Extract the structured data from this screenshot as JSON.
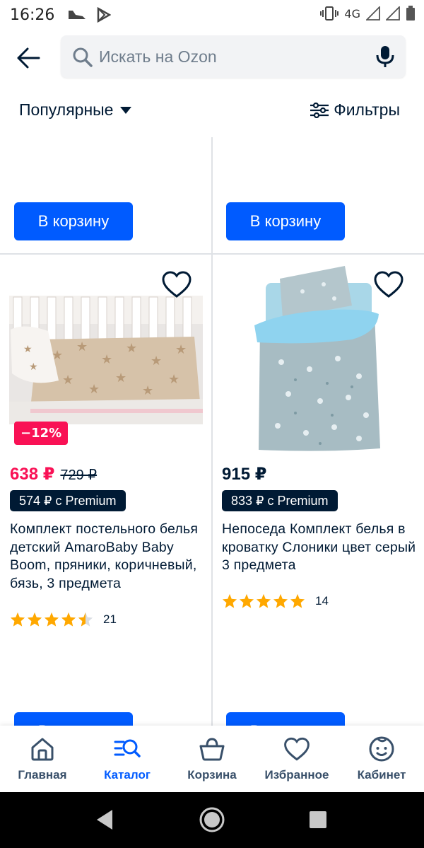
{
  "status_bar": {
    "time": "16:26",
    "network": "4G"
  },
  "search": {
    "placeholder": "Искать на Ozon"
  },
  "sort_bar": {
    "sort_label": "Популярные",
    "filter_label": "Фильтры"
  },
  "top_row": {
    "left_cart_label": "В корзину",
    "right_cart_label": "В корзину"
  },
  "products": [
    {
      "discount": "−12%",
      "price": "638 ₽",
      "old_price": "729 ₽",
      "premium_price": "574 ₽ с Premium",
      "title": "Комплект постельного белья детский AmaroBaby Baby Boom, пряники, коричневый, бязь, 3 предмета",
      "rating": 4.5,
      "reviews": "21",
      "cart_label": "В корзину"
    },
    {
      "price": "915 ₽",
      "premium_price": "833 ₽ с Premium",
      "title": "Непоседа Комплект белья в кроватку Слоники цвет серый 3 предмета",
      "rating": 5,
      "reviews": "14",
      "cart_label": "В корзину"
    }
  ],
  "bottom_nav": {
    "items": [
      {
        "label": "Главная",
        "icon": "home-icon"
      },
      {
        "label": "Каталог",
        "icon": "catalog-icon",
        "active": true
      },
      {
        "label": "Корзина",
        "icon": "cart-icon"
      },
      {
        "label": "Избранное",
        "icon": "heart-icon"
      },
      {
        "label": "Кабинет",
        "icon": "profile-icon"
      }
    ]
  },
  "colors": {
    "accent": "#005bff",
    "sale": "#f91155",
    "dark": "#001a34",
    "star": "#ffa800"
  }
}
